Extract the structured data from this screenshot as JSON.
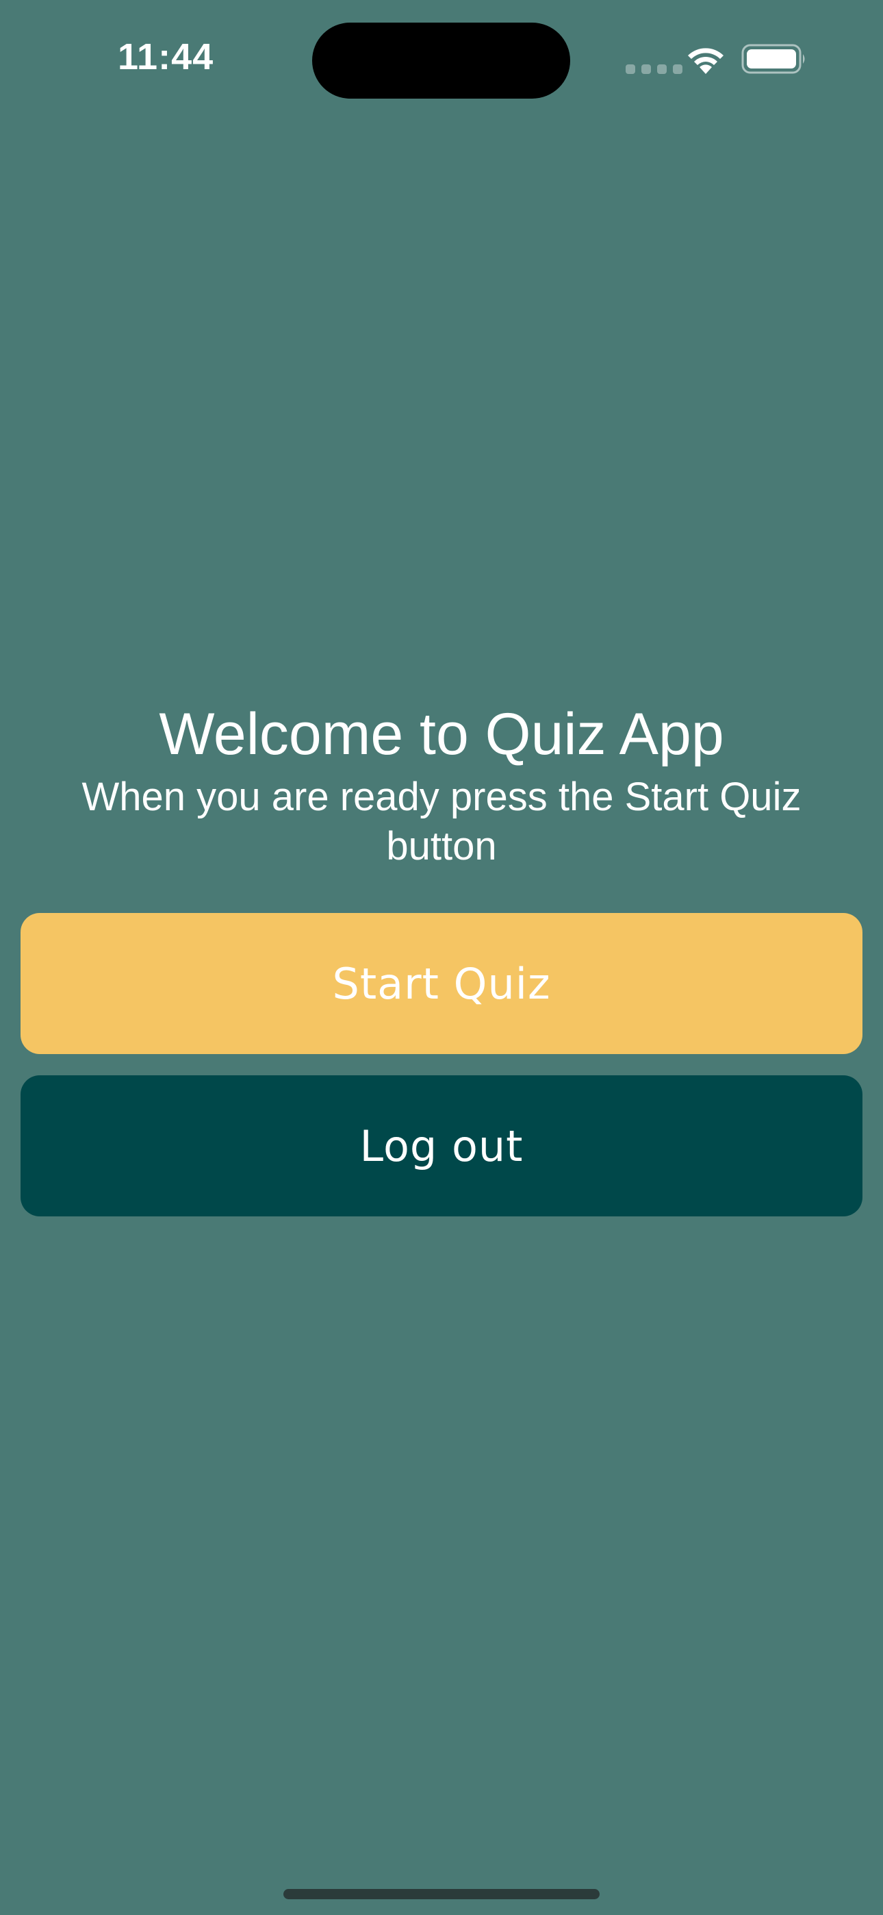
{
  "status_bar": {
    "time": "11:44",
    "wifi_icon": "wifi-icon",
    "battery_icon": "battery-icon"
  },
  "main": {
    "title": "Welcome to Quiz App",
    "subtitle": "When you are ready press the Start Quiz button"
  },
  "buttons": {
    "start_label": "Start Quiz",
    "logout_label": "Log out"
  },
  "colors": {
    "background": "#4a7a75",
    "start_button": "#f5c563",
    "logout_button": "#00484a",
    "text": "#ffffff"
  }
}
